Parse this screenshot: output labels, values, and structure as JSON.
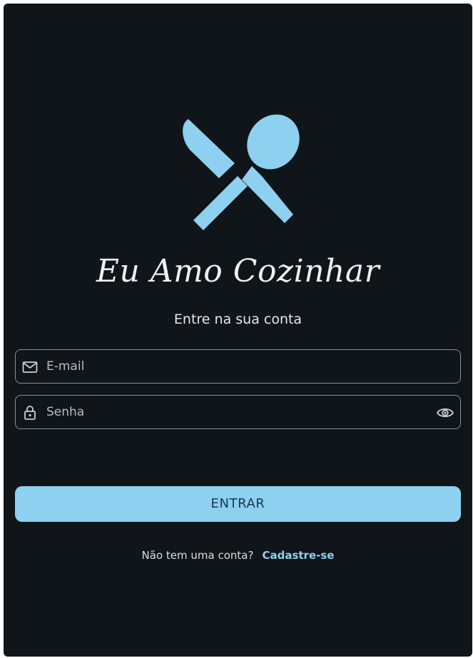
{
  "brand": {
    "app_title": "Eu Amo Cozinhar",
    "subtitle": "Entre na sua conta",
    "accent_color": "#8dd0ef",
    "logo_icon": "fork-knife-spoon-crossed-icon"
  },
  "form": {
    "email_placeholder": "E-mail",
    "password_placeholder": "Senha",
    "email_icon": "mail-icon",
    "password_icon": "lock-icon",
    "visibility_icon": "eye-icon",
    "submit_label": "ENTRAR"
  },
  "footer": {
    "question": "Não tem uma conta?",
    "signup_link": "Cadastre-se"
  }
}
